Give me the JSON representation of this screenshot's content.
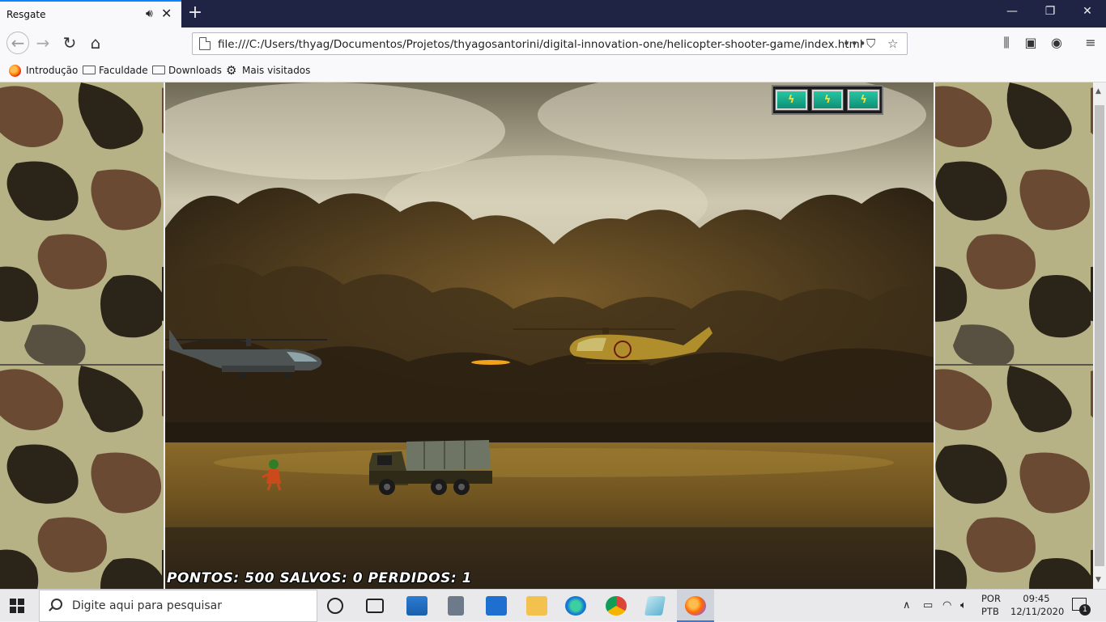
{
  "browser": {
    "tab": {
      "title": "Resgate"
    },
    "url": "file:///C:/Users/thyag/Documentos/Projetos/thyagosantorini/digital-innovation-one/helicopter-shooter-game/index.html",
    "bookmarks": [
      {
        "label": "Introdução",
        "icon": "firefox-icon"
      },
      {
        "label": "Faculdade",
        "icon": "folder-icon"
      },
      {
        "label": "Downloads",
        "icon": "folder-icon"
      },
      {
        "label": "Mais visitados",
        "icon": "gear-icon"
      }
    ]
  },
  "game": {
    "score": "PONTOS: 500 SALVOS: 0 PERDIDOS: 1",
    "energy_bars": 3,
    "energy_symbol": "ϟ"
  },
  "taskbar": {
    "search_placeholder": "Digite aqui para pesquisar",
    "language": {
      "line1": "POR",
      "line2": "PTB"
    },
    "clock": {
      "time": "09:45",
      "date": "12/11/2020"
    },
    "notifications": "1"
  },
  "colors": {
    "tabbar": "#1f2344",
    "accent": "#0a84ff",
    "energy_cell": "#26c6a2",
    "camo_light": "#b7b286",
    "camo_dark": "#2b2418",
    "camo_brown": "#6b4a34"
  }
}
